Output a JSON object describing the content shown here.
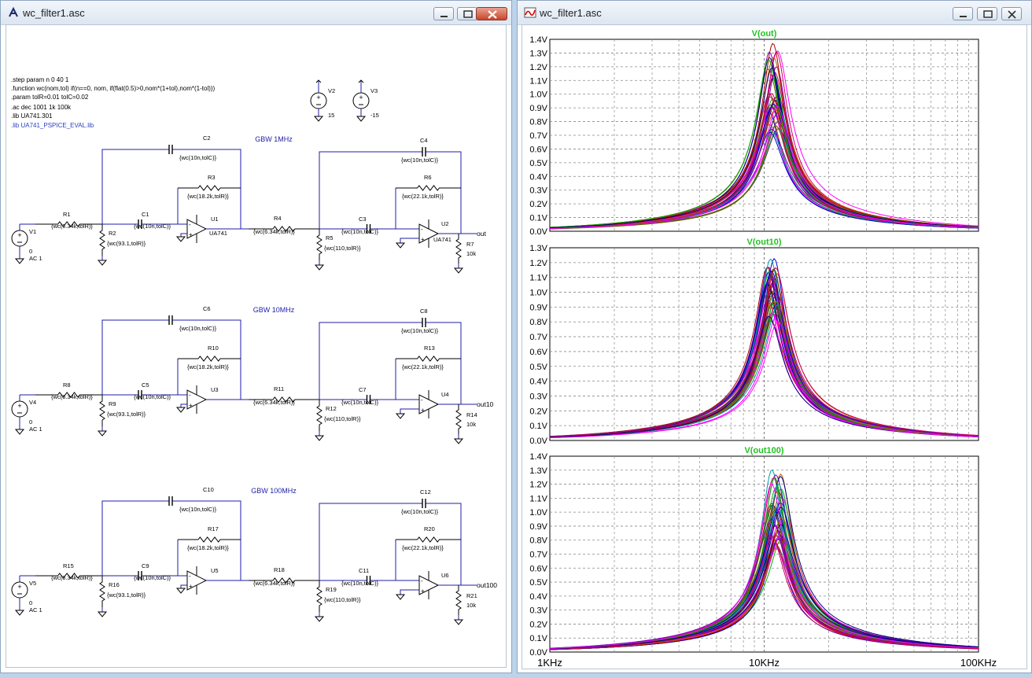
{
  "schematic_window": {
    "title": "wc_filter1.asc",
    "directives": [
      ".step param n 0 40 1",
      ".function wc(nom,tol) if(n==0, nom, if(flat(0.5)>0,nom*(1+tol),nom*(1-tol)))",
      ".param tolR=0.01 tolC=0.02",
      ".ac dec 1001 1k 100k",
      ".lib UA741.301"
    ],
    "lib_directive": ".lib UA741_PSPICE_EVAL.lib",
    "supplies": [
      {
        "name": "V2",
        "value": "15"
      },
      {
        "name": "V3",
        "value": "-15"
      }
    ],
    "stages": [
      {
        "label": "GBW 1MHz",
        "source": "V1",
        "source_dc": "0",
        "source_ac": "AC 1",
        "r_in": "R1",
        "r_in_val": "{wc(6.34k,tolR)}",
        "r_shunt": "R2",
        "r_shunt_val": "{wc(93.1,tolR)}",
        "c_in": "C1",
        "c_in_val": "{wc(10n,tolC)}",
        "c_fb": "C2",
        "c_fb_val": "{wc(10n,tolC)}",
        "r_fb": "R3",
        "r_fb_val": "{wc(18.2k,tolR)}",
        "opamp1": "U1",
        "opamp1_model": "UA741",
        "r_mid": "R4",
        "r_mid_val": "{wc(6.34k,tolR)}",
        "r_shunt2": "R5",
        "r_shunt2_val": "{wc(110,tolR)}",
        "c_in2": "C3",
        "c_in2_val": "{wc(10n,tolC)}",
        "c_fb2": "C4",
        "c_fb2_val": "{wc(10n,tolC)}",
        "r_fb2": "R6",
        "r_fb2_val": "{wc(22.1k,tolR)}",
        "opamp2": "U2",
        "opamp2_model": "UA741",
        "r_load": "R7",
        "r_load_val": "10k",
        "out": "out"
      },
      {
        "label": "GBW 10MHz",
        "source": "V4",
        "source_dc": "0",
        "source_ac": "AC 1",
        "r_in": "R8",
        "r_in_val": "{wc(6.34k,tolR)}",
        "r_shunt": "R9",
        "r_shunt_val": "{wc(93.1,tolR)}",
        "c_in": "C5",
        "c_in_val": "{wc(10n,tolC)}",
        "c_fb": "C6",
        "c_fb_val": "{wc(10n,tolC)}",
        "r_fb": "R10",
        "r_fb_val": "{wc(18.2k,tolR)}",
        "opamp1": "U3",
        "opamp1_model": "",
        "r_mid": "R11",
        "r_mid_val": "{wc(6.34k,tolR)}",
        "r_shunt2": "R12",
        "r_shunt2_val": "{wc(110,tolR)}",
        "c_in2": "C7",
        "c_in2_val": "{wc(10n,tolC)}",
        "c_fb2": "C8",
        "c_fb2_val": "{wc(10n,tolC)}",
        "r_fb2": "R13",
        "r_fb2_val": "{wc(22.1k,tolR)}",
        "opamp2": "U4",
        "opamp2_model": "",
        "r_load": "R14",
        "r_load_val": "10k",
        "out": "out10"
      },
      {
        "label": "GBW 100MHz",
        "source": "V5",
        "source_dc": "0",
        "source_ac": "AC 1",
        "r_in": "R15",
        "r_in_val": "{wc(6.34k,tolR)}",
        "r_shunt": "R16",
        "r_shunt_val": "{wc(93.1,tolR)}",
        "c_in": "C9",
        "c_in_val": "{wc(10n,tolC)}",
        "c_fb": "C10",
        "c_fb_val": "{wc(10n,tolC)}",
        "r_fb": "R17",
        "r_fb_val": "{wc(18.2k,tolR)}",
        "opamp1": "U5",
        "opamp1_model": "",
        "r_mid": "R18",
        "r_mid_val": "{wc(6.34k,tolR)}",
        "r_shunt2": "R19",
        "r_shunt2_val": "{wc(110,tolR)}",
        "c_in2": "C11",
        "c_in2_val": "{wc(10n,tolC)}",
        "c_fb2": "C12",
        "c_fb2_val": "{wc(10n,tolC)}",
        "r_fb2": "R20",
        "r_fb2_val": "{wc(22.1k,tolR)}",
        "opamp2": "U6",
        "opamp2_model": "",
        "r_load": "R21",
        "r_load_val": "10k",
        "out": "out100"
      }
    ]
  },
  "waveform_window": {
    "title": "wc_filter1.asc",
    "x_ticks": [
      "1KHz",
      "10KHz",
      "100KHz"
    ]
  },
  "colors": {
    "wire": "#1f1fa8",
    "trace_title": "#22c322",
    "traces": [
      "#ff00ff",
      "#b00000",
      "#00b000",
      "#0000d0",
      "#00a0a0",
      "#c06000",
      "#606000",
      "#8000c0",
      "#d00060",
      "#000080"
    ]
  },
  "chart_data": [
    {
      "type": "line",
      "title": "V(out)",
      "x_scale": "log",
      "xlim": [
        1000,
        100000
      ],
      "ylim": [
        0,
        1.4
      ],
      "y_ticks": [
        "1.4V",
        "1.3V",
        "1.2V",
        "1.1V",
        "1.0V",
        "0.9V",
        "0.8V",
        "0.7V",
        "0.6V",
        "0.5V",
        "0.4V",
        "0.3V",
        "0.2V",
        "0.1V",
        "0.0V"
      ],
      "grid": true,
      "center_frequency": 11000,
      "peak_min": 0.72,
      "peak_max": 1.39,
      "runs": 41
    },
    {
      "type": "line",
      "title": "V(out10)",
      "x_scale": "log",
      "xlim": [
        1000,
        100000
      ],
      "ylim": [
        0,
        1.3
      ],
      "y_ticks": [
        "1.3V",
        "1.2V",
        "1.1V",
        "1.0V",
        "0.9V",
        "0.8V",
        "0.7V",
        "0.6V",
        "0.5V",
        "0.4V",
        "0.3V",
        "0.2V",
        "0.1V",
        "0.0V"
      ],
      "grid": true,
      "center_frequency": 11000,
      "peak_min": 0.78,
      "peak_max": 1.26,
      "runs": 41
    },
    {
      "type": "line",
      "title": "V(out100)",
      "x_scale": "log",
      "xlim": [
        1000,
        100000
      ],
      "ylim": [
        0,
        1.4
      ],
      "y_ticks": [
        "1.4V",
        "1.3V",
        "1.2V",
        "1.1V",
        "1.0V",
        "0.9V",
        "0.8V",
        "0.7V",
        "0.6V",
        "0.5V",
        "0.4V",
        "0.3V",
        "0.2V",
        "0.1V",
        "0.0V"
      ],
      "grid": true,
      "center_frequency": 11500,
      "peak_min": 0.71,
      "peak_max": 1.32,
      "runs": 41
    }
  ]
}
